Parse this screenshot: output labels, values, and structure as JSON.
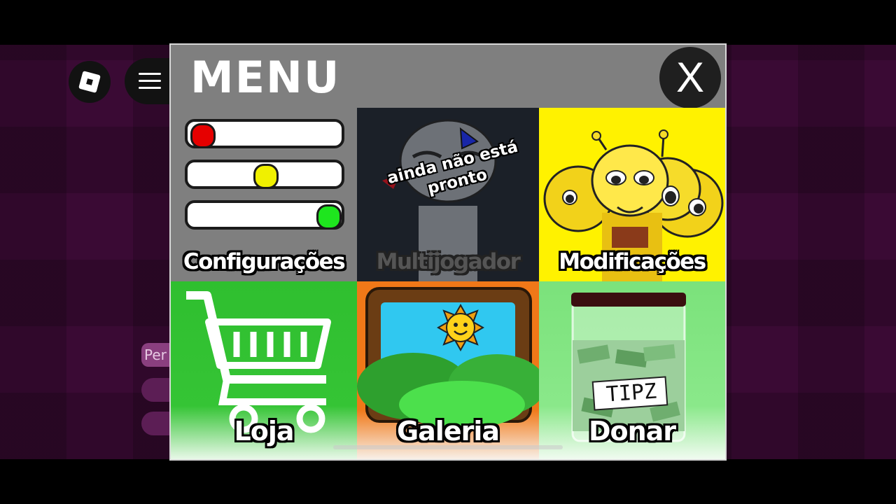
{
  "roblox": {
    "logo_icon": "roblox-logo-icon",
    "menu_icon": "hamburger-menu-icon",
    "chat_icon": "chat-icon"
  },
  "background": {
    "partial_label": "Per"
  },
  "menu": {
    "title": "MENU",
    "close_label": "X",
    "tiles": [
      {
        "id": "configuracoes",
        "label": "Configurações",
        "color": "#7f7f7f"
      },
      {
        "id": "multijogador",
        "label": "Multijogador",
        "note": "ainda não está pronto",
        "color": "#1e232b"
      },
      {
        "id": "modificacoes",
        "label": "Modificações",
        "color": "#fff200"
      },
      {
        "id": "loja",
        "label": "Loja",
        "color": "#2fbf2f"
      },
      {
        "id": "galeria",
        "label": "Galeria",
        "color": "#f07818"
      },
      {
        "id": "donar",
        "label": "Donar",
        "jar_label": "TIPZ",
        "color": "#7be27b"
      }
    ],
    "settings_sliders": [
      {
        "knob_color": "#e60000",
        "level": 0.0
      },
      {
        "knob_color": "#f0f000",
        "level": 0.5
      },
      {
        "knob_color": "#1ee61e",
        "level": 1.0
      }
    ]
  }
}
